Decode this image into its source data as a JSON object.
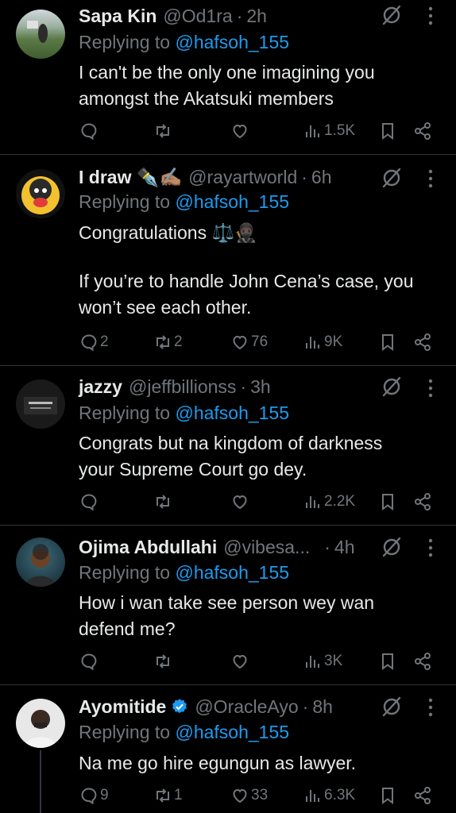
{
  "colors": {
    "background": "#000000",
    "text": "#e7e9ea",
    "muted": "#71767b",
    "link": "#1d9bf0",
    "divider": "#2f3336",
    "verified": "#1d9bf0"
  },
  "icons": {
    "reply": "reply-icon",
    "repost": "repost-icon",
    "like": "heart-icon",
    "views": "views-icon",
    "bookmark": "bookmark-icon",
    "share": "share-icon",
    "grok": "grok-icon",
    "more": "more-icon"
  },
  "tweets": [
    {
      "name": "Sapa Kin",
      "handle": "@Od1ra",
      "time": "2h",
      "reply_label": "Replying to",
      "reply_to": "@hafsoh_155",
      "text_lines": [
        "I can't be the only one imagining you",
        "amongst the Akatsuki members"
      ],
      "replies": "",
      "reposts": "",
      "likes": "",
      "views": "1.5K"
    },
    {
      "name": "I draw ✒️✍🏽",
      "handle": "@rayartworld",
      "time": "6h",
      "reply_label": "Replying to",
      "reply_to": "@hafsoh_155",
      "text_lines": [
        "Congratulations ⚖️🥷🏿",
        "",
        "If you’re to handle John Cena’s case, you",
        "won’t see each other."
      ],
      "replies": "2",
      "reposts": "2",
      "likes": "76",
      "views": "9K"
    },
    {
      "name": "jazzy",
      "handle": "@jeffbillionss",
      "time": "3h",
      "reply_label": "Replying to",
      "reply_to": "@hafsoh_155",
      "text_lines": [
        "Congrats but na kingdom of darkness",
        "your Supreme Court go dey."
      ],
      "replies": "",
      "reposts": "",
      "likes": "",
      "views": "2.2K"
    },
    {
      "name": "Ojima Abdullahi",
      "handle": "@vibesa...",
      "time": "4h",
      "reply_label": "Replying to",
      "reply_to": "@hafsoh_155",
      "text_lines": [
        "How i wan take see person wey wan",
        "defend me?"
      ],
      "replies": "",
      "reposts": "",
      "likes": "",
      "views": "3K"
    },
    {
      "name": "Ayomitide",
      "handle": "@OracleAyo",
      "time": "8h",
      "verified": true,
      "reply_label": "Replying to",
      "reply_to": "@hafsoh_155",
      "text_lines": [
        "Na me go hire egungun as lawyer."
      ],
      "replies": "9",
      "reposts": "1",
      "likes": "33",
      "views": "6.3K"
    }
  ]
}
